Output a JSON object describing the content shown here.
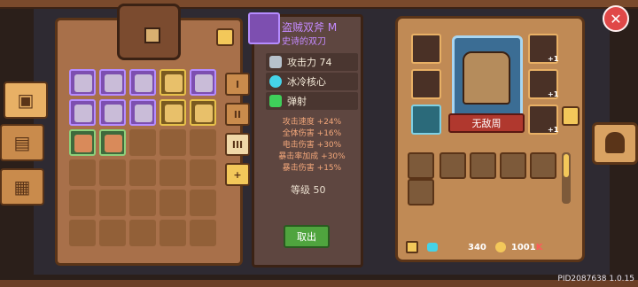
{
  "weapon": {
    "name": "盗贼双斧 M",
    "subtitle": "史诗的双刀",
    "attack_label": "攻击力 74",
    "core_label": "冰冷核心",
    "mode_label": "弹射",
    "bonuses": [
      "攻击速度 +24%",
      "全体伤害 +16%",
      "电击伤害 +30%",
      "暴击率加成 +30%",
      "暴击伤害 +15%"
    ],
    "level_label": "等级 50",
    "takeout_label": "取出"
  },
  "inventory": {
    "page_tabs": [
      "I",
      "II",
      "III",
      "+"
    ],
    "active_page": 2
  },
  "hero": {
    "name_label": "无敌周",
    "plus_badges": [
      "+1",
      "+1",
      "+1"
    ]
  },
  "currency": {
    "gems": "340",
    "coins": "1001",
    "coins_suffix": "K"
  },
  "build": {
    "version_text": "PID2087638 1.0.15"
  },
  "colors": {
    "epic": "#b58cff",
    "legendary": "#e6c04a",
    "rare": "#8dd07a",
    "panel_wood": "#a8704a",
    "hero_name_bg": "#b0382e",
    "takeout_button": "#4fa43e",
    "close_button": "#e04848"
  },
  "icons": {
    "close": "close-icon",
    "chest": "chest-icon",
    "sort": "sort-icon",
    "lock": "lock-icon",
    "gem": "gem-icon",
    "coin": "coin-icon",
    "helmet": "helmet-icon"
  }
}
